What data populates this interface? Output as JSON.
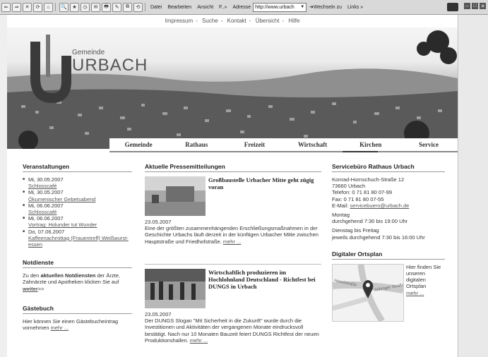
{
  "toolbar": {
    "buttons": [
      "⇐",
      "⇒",
      "✕",
      "⟳",
      "⌂",
      "🔍",
      "★",
      "◷",
      "✉",
      "🖶",
      "✎",
      "⧉",
      "⟲"
    ],
    "menu": [
      "Datei",
      "Bearbeiten",
      "Ansicht",
      "F..»"
    ],
    "address_label": "Adresse",
    "address_value": "http://www.urbach",
    "go_label": "Wechseln zu",
    "links_label": "Links »"
  },
  "topnav": [
    "Impressum",
    "Suche",
    "Kontakt",
    "Übersicht",
    "Hilfe"
  ],
  "logo": {
    "small": "Gemeinde",
    "big": "URBACH"
  },
  "mainnav": [
    "Gemeinde",
    "Rathaus",
    "Freizeit",
    "Wirtschaft",
    "Kirchen",
    "Service"
  ],
  "events": {
    "title": "Veranstaltungen",
    "items": [
      {
        "date": "Mi, 30.05.2007",
        "name": "Schlosscafé"
      },
      {
        "date": "Mi, 30.05.2007",
        "name": "Ökumenischer Gebetsabend"
      },
      {
        "date": "Mi, 06.06.2007",
        "name": "Schlosscafé"
      },
      {
        "date": "Mi, 06.06.2007",
        "name": "Vortrag: Holunder tut Wunder"
      },
      {
        "date": "Do, 07.06.2007",
        "name": "Kaffeenachmittag (Frauentreff) Weißwurst-essen"
      }
    ]
  },
  "notdienste": {
    "title": "Notdienste",
    "text_before": "Zu den ",
    "bold": "aktuellen Notdiensten",
    "text_after": " der Ärzte, Zahnärzte und Apotheken klicken Sie auf ",
    "link": "weiter",
    "suffix": ">>"
  },
  "gaestebuch": {
    "title": "Gästebuch",
    "text": "Hier können Sie einen Gästebucheintrag vornehmen ",
    "link": "mehr ..."
  },
  "press": {
    "title": "Aktuelle Pressemitteilungen",
    "items": [
      {
        "title": "Großbaustelle Urbacher Mitte geht zügig voran",
        "date": "23.05.2007",
        "text": "Eine der größten zusammenhängenden Erschließungsmaßnahmen in der Geschichte Urbachs läuft derzeit in der künftigen Urbacher Mitte zwischen Hauptstraße und Friedhofstraße. ",
        "more": "mehr ..."
      },
      {
        "title": "Wirtschaftlich produzieren im Hochlohnland Deutschland - Richtfest bei DUNGS in Urbach",
        "date": "23.05.2007",
        "text": "Der DUNGS Slogan \"Mit Sicherheit in die Zukunft\" wurde durch die Investitionen und Aktivitäten der vergangenen Monate eindrucksvoll bestätigt. Nach nur 10 Monaten Bauzeit feiert DUNGS Richtfest der neuen Produktionshallen. ",
        "more": "mehr ..."
      }
    ]
  },
  "service": {
    "title": "Servicebüro Rathaus Urbach",
    "address1": "Konrad-Hornschuch-Straße 12",
    "address2": "73660 Urbach",
    "phone": "Telefon: 0 71 81 80 07-99",
    "fax": "Fax: 0 71 81 80 07-55",
    "email_label": "E-Mail: ",
    "email": "servicebuero@urbach.de",
    "hours1_day": "Montag",
    "hours1_time": "durchgehend 7:30 bis 19:00 Uhr",
    "hours2_day": "Dienstag bis Freitag",
    "hours2_time": "jeweils durchgehend 7:30 bis 16:00 Uhr"
  },
  "map": {
    "title": "Digitaler Ortsplan",
    "text": "Hier finden Sie unseren digitalen Ortsplan",
    "more": "mehr ...",
    "street1": "Haselstraße",
    "street2": "Vaihinger Straße"
  }
}
